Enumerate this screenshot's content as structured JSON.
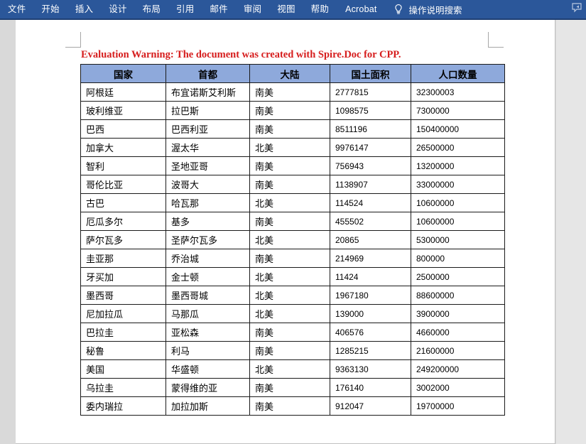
{
  "ribbon": {
    "menu_items": [
      {
        "label": "文件",
        "name": "tab-file"
      },
      {
        "label": "开始",
        "name": "tab-home"
      },
      {
        "label": "插入",
        "name": "tab-insert"
      },
      {
        "label": "设计",
        "name": "tab-design"
      },
      {
        "label": "布局",
        "name": "tab-layout"
      },
      {
        "label": "引用",
        "name": "tab-references"
      },
      {
        "label": "邮件",
        "name": "tab-mailings"
      },
      {
        "label": "审阅",
        "name": "tab-review"
      },
      {
        "label": "视图",
        "name": "tab-view"
      },
      {
        "label": "帮助",
        "name": "tab-help"
      },
      {
        "label": "Acrobat",
        "name": "tab-acrobat"
      }
    ],
    "tell_me": {
      "icon": "lightbulb-icon",
      "label": "操作说明搜索"
    },
    "right_icon": "share-icon",
    "background_color": "#2b579a"
  },
  "document": {
    "evaluation_warning": "Evaluation Warning: The document was created with Spire.Doc for CPP.",
    "warning_color": "#d61d1d"
  },
  "table": {
    "header_fill": "#8ea9db",
    "border_color": "#1a1a1a",
    "columns": [
      "国家",
      "首都",
      "大陆",
      "国土面积",
      "人口数量"
    ],
    "rows": [
      [
        "阿根廷",
        "布宜诺斯艾利斯",
        "南美",
        "2777815",
        "32300003"
      ],
      [
        "玻利维亚",
        "拉巴斯",
        "南美",
        "1098575",
        "7300000"
      ],
      [
        "巴西",
        "巴西利亚",
        "南美",
        "8511196",
        "150400000"
      ],
      [
        "加拿大",
        "渥太华",
        "北美",
        "9976147",
        "26500000"
      ],
      [
        "智利",
        "圣地亚哥",
        "南美",
        "756943",
        "13200000"
      ],
      [
        "哥伦比亚",
        "波哥大",
        "南美",
        "1138907",
        "33000000"
      ],
      [
        "古巴",
        "哈瓦那",
        "北美",
        "114524",
        "10600000"
      ],
      [
        "厄瓜多尔",
        "基多",
        "南美",
        "455502",
        "10600000"
      ],
      [
        "萨尔瓦多",
        "圣萨尔瓦多",
        "北美",
        "20865",
        "5300000"
      ],
      [
        "圭亚那",
        "乔治城",
        "南美",
        "214969",
        "800000"
      ],
      [
        "牙买加",
        "金士顿",
        "北美",
        "11424",
        "2500000"
      ],
      [
        "墨西哥",
        "墨西哥城",
        "北美",
        "1967180",
        "88600000"
      ],
      [
        "尼加拉瓜",
        "马那瓜",
        "北美",
        "139000",
        "3900000"
      ],
      [
        "巴拉圭",
        "亚松森",
        "南美",
        "406576",
        "4660000"
      ],
      [
        "秘鲁",
        "利马",
        "南美",
        "1285215",
        "21600000"
      ],
      [
        "美国",
        "华盛顿",
        "北美",
        "9363130",
        "249200000"
      ],
      [
        "乌拉圭",
        "蒙得维的亚",
        "南美",
        "176140",
        "3002000"
      ],
      [
        "委内瑞拉",
        "加拉加斯",
        "南美",
        "912047",
        "19700000"
      ]
    ]
  }
}
